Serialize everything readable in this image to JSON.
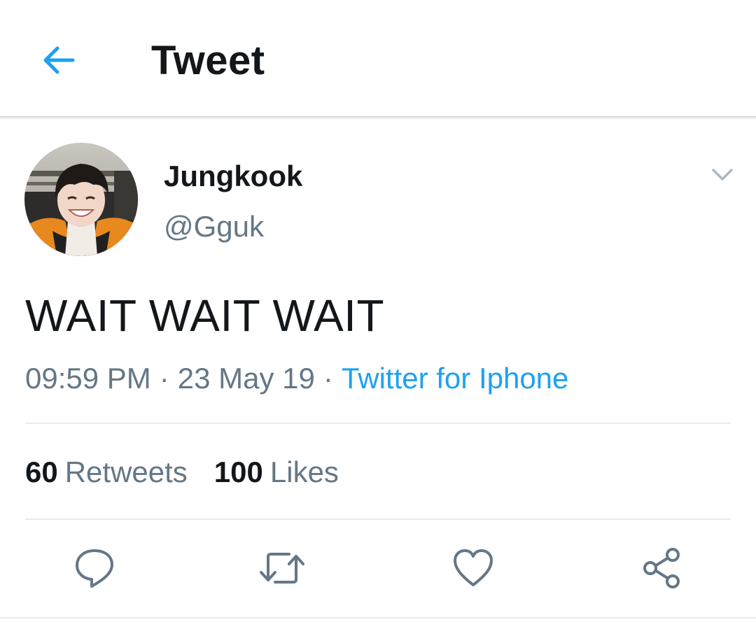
{
  "header": {
    "title": "Tweet",
    "back_icon": "arrow-left-icon",
    "accent_color": "#1da1f2"
  },
  "author": {
    "display_name": "Jungkook",
    "handle": "@Gguk",
    "caret_icon": "chevron-down-icon"
  },
  "tweet": {
    "text": "WAIT WAIT WAIT",
    "time": "09:59 PM",
    "date": "23 May 19",
    "separator": "·",
    "source": "Twitter for Iphone"
  },
  "stats": {
    "retweets_count": "60",
    "retweets_label": "Retweets",
    "likes_count": "100",
    "likes_label": "Likes"
  },
  "actions": [
    {
      "name": "reply",
      "icon": "reply-bubble-icon"
    },
    {
      "name": "retweet",
      "icon": "retweet-icon"
    },
    {
      "name": "like",
      "icon": "heart-icon"
    },
    {
      "name": "share",
      "icon": "share-icon"
    }
  ],
  "colors": {
    "text_primary": "#14171a",
    "text_secondary": "#657786",
    "link": "#1da1f2",
    "divider": "#e6ecf0"
  }
}
